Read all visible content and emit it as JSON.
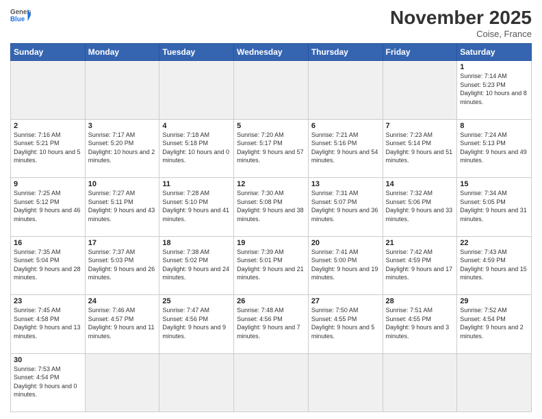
{
  "header": {
    "logo_general": "General",
    "logo_blue": "Blue",
    "month_title": "November 2025",
    "location": "Coise, France"
  },
  "days_of_week": [
    "Sunday",
    "Monday",
    "Tuesday",
    "Wednesday",
    "Thursday",
    "Friday",
    "Saturday"
  ],
  "weeks": [
    [
      {
        "day": "",
        "info": ""
      },
      {
        "day": "",
        "info": ""
      },
      {
        "day": "",
        "info": ""
      },
      {
        "day": "",
        "info": ""
      },
      {
        "day": "",
        "info": ""
      },
      {
        "day": "",
        "info": ""
      },
      {
        "day": "1",
        "info": "Sunrise: 7:14 AM\nSunset: 5:23 PM\nDaylight: 10 hours and 8 minutes."
      }
    ],
    [
      {
        "day": "2",
        "info": "Sunrise: 7:16 AM\nSunset: 5:21 PM\nDaylight: 10 hours and 5 minutes."
      },
      {
        "day": "3",
        "info": "Sunrise: 7:17 AM\nSunset: 5:20 PM\nDaylight: 10 hours and 2 minutes."
      },
      {
        "day": "4",
        "info": "Sunrise: 7:18 AM\nSunset: 5:18 PM\nDaylight: 10 hours and 0 minutes."
      },
      {
        "day": "5",
        "info": "Sunrise: 7:20 AM\nSunset: 5:17 PM\nDaylight: 9 hours and 57 minutes."
      },
      {
        "day": "6",
        "info": "Sunrise: 7:21 AM\nSunset: 5:16 PM\nDaylight: 9 hours and 54 minutes."
      },
      {
        "day": "7",
        "info": "Sunrise: 7:23 AM\nSunset: 5:14 PM\nDaylight: 9 hours and 51 minutes."
      },
      {
        "day": "8",
        "info": "Sunrise: 7:24 AM\nSunset: 5:13 PM\nDaylight: 9 hours and 49 minutes."
      }
    ],
    [
      {
        "day": "9",
        "info": "Sunrise: 7:25 AM\nSunset: 5:12 PM\nDaylight: 9 hours and 46 minutes."
      },
      {
        "day": "10",
        "info": "Sunrise: 7:27 AM\nSunset: 5:11 PM\nDaylight: 9 hours and 43 minutes."
      },
      {
        "day": "11",
        "info": "Sunrise: 7:28 AM\nSunset: 5:10 PM\nDaylight: 9 hours and 41 minutes."
      },
      {
        "day": "12",
        "info": "Sunrise: 7:30 AM\nSunset: 5:08 PM\nDaylight: 9 hours and 38 minutes."
      },
      {
        "day": "13",
        "info": "Sunrise: 7:31 AM\nSunset: 5:07 PM\nDaylight: 9 hours and 36 minutes."
      },
      {
        "day": "14",
        "info": "Sunrise: 7:32 AM\nSunset: 5:06 PM\nDaylight: 9 hours and 33 minutes."
      },
      {
        "day": "15",
        "info": "Sunrise: 7:34 AM\nSunset: 5:05 PM\nDaylight: 9 hours and 31 minutes."
      }
    ],
    [
      {
        "day": "16",
        "info": "Sunrise: 7:35 AM\nSunset: 5:04 PM\nDaylight: 9 hours and 28 minutes."
      },
      {
        "day": "17",
        "info": "Sunrise: 7:37 AM\nSunset: 5:03 PM\nDaylight: 9 hours and 26 minutes."
      },
      {
        "day": "18",
        "info": "Sunrise: 7:38 AM\nSunset: 5:02 PM\nDaylight: 9 hours and 24 minutes."
      },
      {
        "day": "19",
        "info": "Sunrise: 7:39 AM\nSunset: 5:01 PM\nDaylight: 9 hours and 21 minutes."
      },
      {
        "day": "20",
        "info": "Sunrise: 7:41 AM\nSunset: 5:00 PM\nDaylight: 9 hours and 19 minutes."
      },
      {
        "day": "21",
        "info": "Sunrise: 7:42 AM\nSunset: 4:59 PM\nDaylight: 9 hours and 17 minutes."
      },
      {
        "day": "22",
        "info": "Sunrise: 7:43 AM\nSunset: 4:59 PM\nDaylight: 9 hours and 15 minutes."
      }
    ],
    [
      {
        "day": "23",
        "info": "Sunrise: 7:45 AM\nSunset: 4:58 PM\nDaylight: 9 hours and 13 minutes."
      },
      {
        "day": "24",
        "info": "Sunrise: 7:46 AM\nSunset: 4:57 PM\nDaylight: 9 hours and 11 minutes."
      },
      {
        "day": "25",
        "info": "Sunrise: 7:47 AM\nSunset: 4:56 PM\nDaylight: 9 hours and 9 minutes."
      },
      {
        "day": "26",
        "info": "Sunrise: 7:48 AM\nSunset: 4:56 PM\nDaylight: 9 hours and 7 minutes."
      },
      {
        "day": "27",
        "info": "Sunrise: 7:50 AM\nSunset: 4:55 PM\nDaylight: 9 hours and 5 minutes."
      },
      {
        "day": "28",
        "info": "Sunrise: 7:51 AM\nSunset: 4:55 PM\nDaylight: 9 hours and 3 minutes."
      },
      {
        "day": "29",
        "info": "Sunrise: 7:52 AM\nSunset: 4:54 PM\nDaylight: 9 hours and 2 minutes."
      }
    ],
    [
      {
        "day": "30",
        "info": "Sunrise: 7:53 AM\nSunset: 4:54 PM\nDaylight: 9 hours and 0 minutes."
      },
      {
        "day": "",
        "info": ""
      },
      {
        "day": "",
        "info": ""
      },
      {
        "day": "",
        "info": ""
      },
      {
        "day": "",
        "info": ""
      },
      {
        "day": "",
        "info": ""
      },
      {
        "day": "",
        "info": ""
      }
    ]
  ]
}
